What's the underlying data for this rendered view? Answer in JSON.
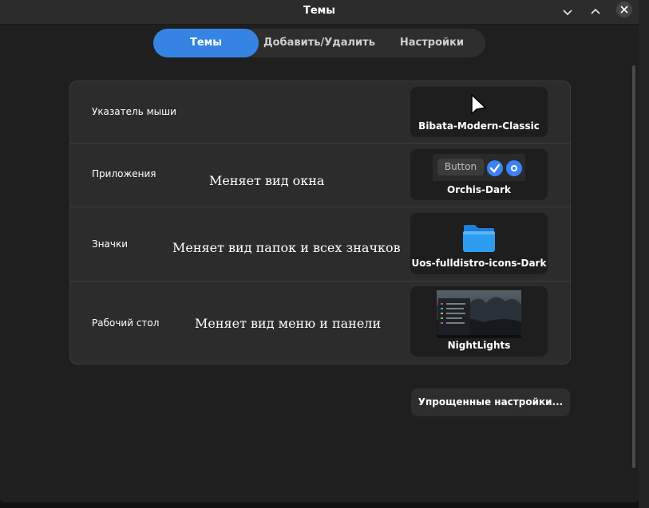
{
  "window": {
    "title": "Темы"
  },
  "tabs": [
    {
      "label": "Темы",
      "active": true
    },
    {
      "label": "Добавить/Удалить",
      "active": false
    },
    {
      "label": "Настройки",
      "active": false
    }
  ],
  "rows": {
    "cursor": {
      "label": "Указатель мыши",
      "theme": "Bibata-Modern-Classic"
    },
    "apps": {
      "label": "Приложения",
      "annotation": "Меняет вид окна",
      "theme": "Orchis-Dark",
      "button_text": "Button"
    },
    "icons": {
      "label": "Значки",
      "annotation": "Меняет вид папок и всех значков",
      "theme": "Uos-fulldistro-icons-Dark"
    },
    "desktop": {
      "label": "Рабочий стол",
      "annotation": "Меняет вид меню и панели",
      "theme": "NightLights"
    }
  },
  "simple_settings_button": "Упрощенные настройки...",
  "colors": {
    "accent": "#3584e4",
    "background": "#1f1f1f",
    "card": "#2c2c2c",
    "folder": "#2d9cf0"
  },
  "icons": [
    "minimize-icon",
    "maximize-icon",
    "close-icon",
    "cursor-pointer-icon",
    "check-icon",
    "radio-icon",
    "folder-icon"
  ]
}
